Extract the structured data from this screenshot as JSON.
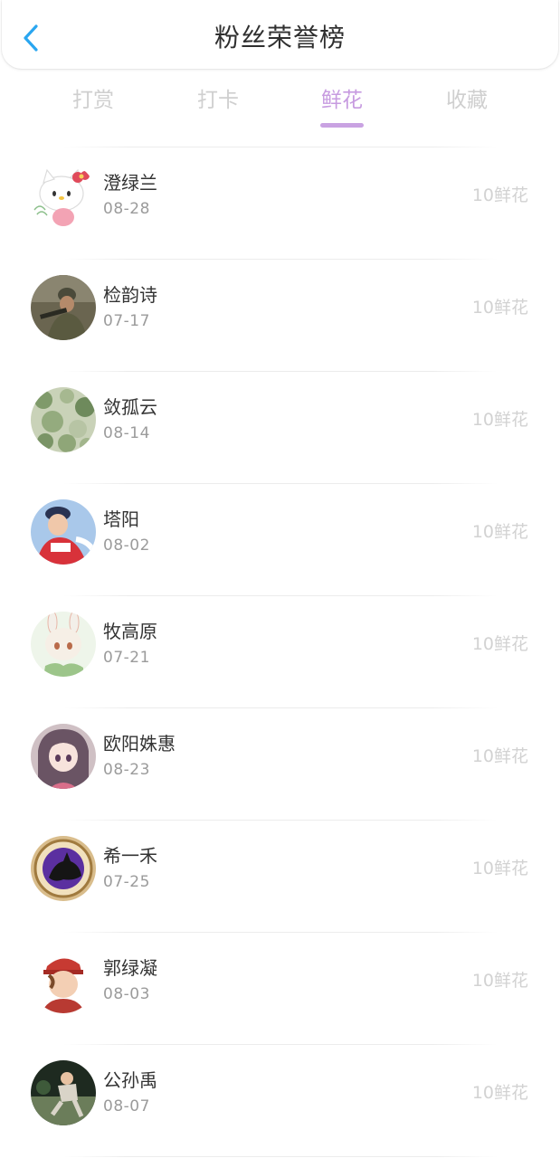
{
  "header": {
    "title": "粉丝荣誉榜"
  },
  "tabs": [
    {
      "label": "打赏",
      "active": false
    },
    {
      "label": "打卡",
      "active": false
    },
    {
      "label": "鲜花",
      "active": true
    },
    {
      "label": "收藏",
      "active": false
    }
  ],
  "colors": {
    "accent": "#c79be0",
    "back_icon": "#2aa6f0",
    "inactive_tab": "#cfcfcf"
  },
  "fans": [
    {
      "name": "澄绿兰",
      "date": "08-28",
      "amount": "10鲜花",
      "avatar": "hello-kitty-avatar"
    },
    {
      "name": "检韵诗",
      "date": "07-17",
      "amount": "10鲜花",
      "avatar": "soldier-avatar"
    },
    {
      "name": "敛孤云",
      "date": "08-14",
      "amount": "10鲜花",
      "avatar": "green-pattern-avatar"
    },
    {
      "name": "塔阳",
      "date": "08-02",
      "amount": "10鲜花",
      "avatar": "girl-red-jacket-avatar"
    },
    {
      "name": "牧高原",
      "date": "07-21",
      "amount": "10鲜花",
      "avatar": "bunny-girl-avatar"
    },
    {
      "name": "欧阳姝惠",
      "date": "08-23",
      "amount": "10鲜花",
      "avatar": "anime-girl-avatar"
    },
    {
      "name": "希一禾",
      "date": "07-25",
      "amount": "10鲜花",
      "avatar": "black-horse-avatar"
    },
    {
      "name": "郭绿凝",
      "date": "08-03",
      "amount": "10鲜花",
      "avatar": "red-cap-boy-avatar"
    },
    {
      "name": "公孙禹",
      "date": "08-07",
      "amount": "10鲜花",
      "avatar": "sports-photo-avatar"
    }
  ]
}
